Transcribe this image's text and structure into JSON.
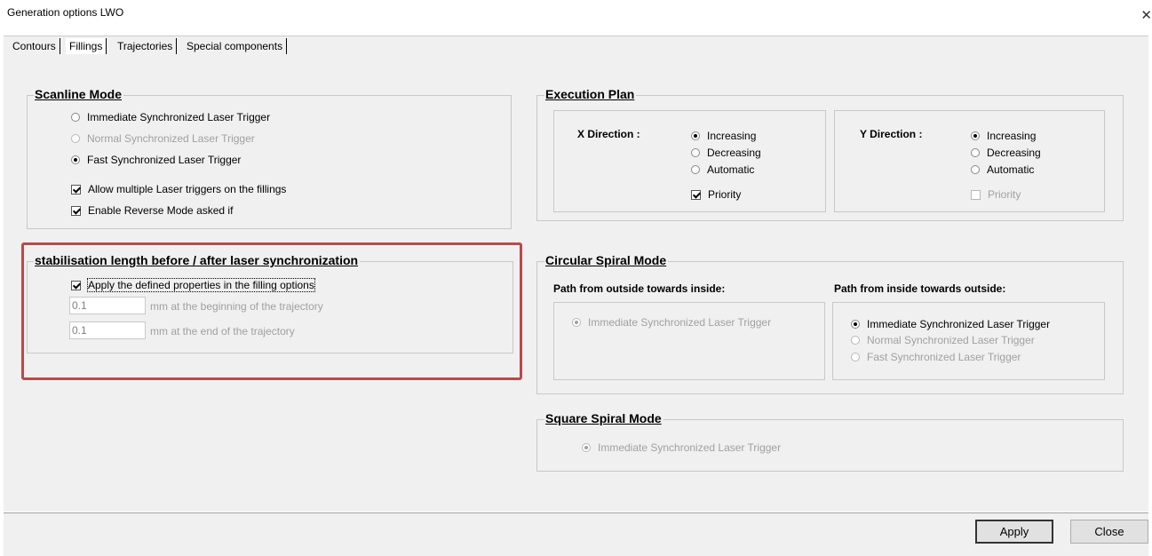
{
  "window": {
    "title": "Generation options LWO",
    "close_glyph": "✕"
  },
  "tabs": [
    "Contours",
    "Fillings",
    "Trajectories",
    "Special components"
  ],
  "active_tab": 1,
  "scanline": {
    "title": "Scanline Mode",
    "options": [
      "Immediate Synchronized Laser Trigger",
      "Normal Synchronized Laser Trigger",
      "Fast Synchronized Laser Trigger"
    ],
    "selected": 2,
    "checks": [
      "Allow multiple Laser triggers on the fillings",
      "Enable Reverse Mode asked if"
    ]
  },
  "stabilisation": {
    "title": "stabilisation length before / after laser synchronization",
    "apply_label": "Apply the defined properties in the filling options",
    "begin_value": "0.1",
    "begin_label": "mm at the beginning of the trajectory",
    "end_value": "0.1",
    "end_label": "mm at the end of the trajectory"
  },
  "execution": {
    "title": "Execution Plan",
    "x": {
      "label": "X Direction :",
      "options": [
        "Increasing",
        "Decreasing",
        "Automatic"
      ],
      "priority": "Priority"
    },
    "y": {
      "label": "Y Direction :",
      "options": [
        "Increasing",
        "Decreasing",
        "Automatic"
      ],
      "priority": "Priority"
    }
  },
  "circular": {
    "title": "Circular Spiral Mode",
    "outside_in_label": "Path from outside towards inside:",
    "outside_in_option": "Immediate Synchronized Laser Trigger",
    "inside_out_label": "Path from inside towards outside:",
    "inside_out_options": [
      "Immediate Synchronized Laser Trigger",
      "Normal Synchronized Laser Trigger",
      "Fast Synchronized Laser Trigger"
    ]
  },
  "square": {
    "title": "Square Spiral Mode",
    "option": "Immediate Synchronized Laser Trigger"
  },
  "buttons": {
    "apply": "Apply",
    "close": "Close"
  },
  "colors": {
    "highlight": "#b94a48",
    "dialog_bg": "#f0f0f0"
  }
}
